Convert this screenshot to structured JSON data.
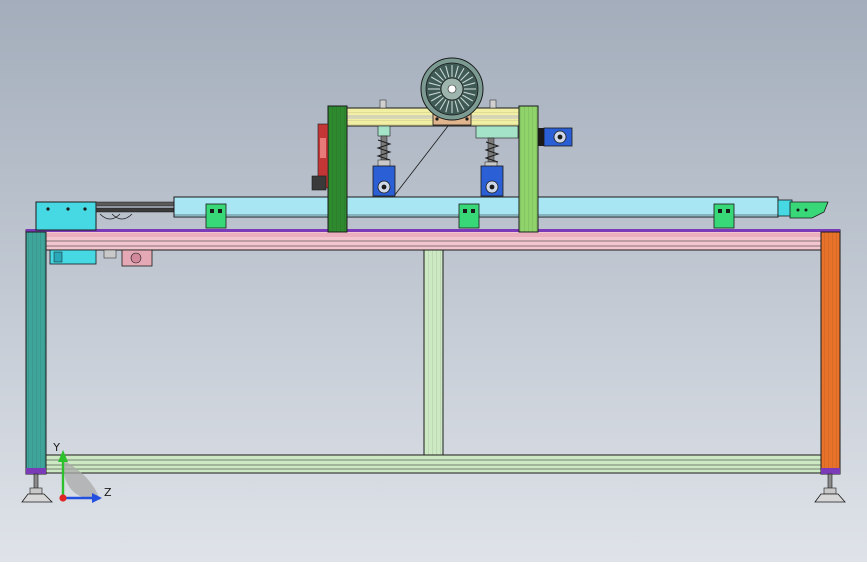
{
  "viewport": {
    "background_top": "#a3adbb",
    "background_bottom": "#dfe3e9"
  },
  "colors": {
    "frame_teal": "#3fa59a",
    "frame_orange": "#e8722a",
    "frame_pink": "#f3c6cf",
    "frame_gray": "#dfe7e6",
    "frame_green": "#cde9c4",
    "gantry_dark_green": "#2f8a2f",
    "gantry_light_green": "#8fd36a",
    "conveyor_cyan": "#a9e6f4",
    "box_cyan": "#46d9e4",
    "block_green": "#38d778",
    "motor_blue": "#2a5fd6",
    "wheel_dark": "#3f5a54",
    "wheel_mid": "#7a9a92",
    "bracket_tan": "#e0b48c",
    "red_part": "#c23636",
    "purple_edge": "#7b3ab8",
    "outline": "#1a1a1a"
  },
  "triad": {
    "y_label": "Y",
    "z_label": "Z",
    "y_icon": "y-axis-arrow-icon",
    "z_icon": "z-axis-arrow-icon",
    "origin_icon": "origin-dot-icon",
    "y_color": "#2cc02c",
    "z_color": "#2450e0",
    "x_color": "#e02424"
  }
}
